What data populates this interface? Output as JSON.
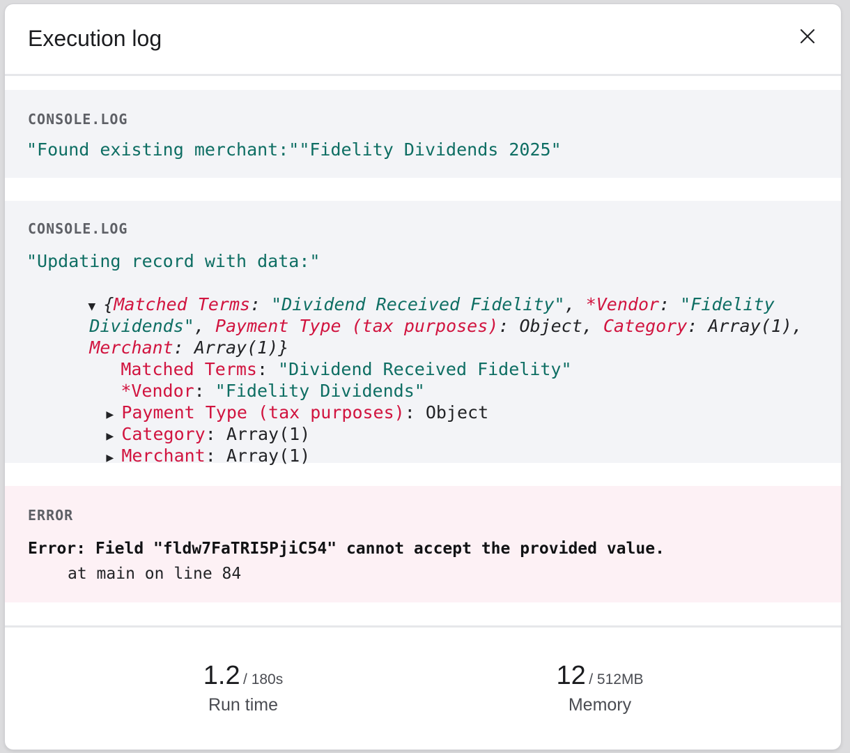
{
  "header": {
    "title": "Execution log"
  },
  "logs": [
    {
      "label": "CONSOLE.LOG",
      "message": "\"Found existing merchant:\"\"Fidelity Dividends 2025\""
    },
    {
      "label": "CONSOLE.LOG",
      "message": "\"Updating record with data:\"",
      "summary": {
        "open": "{",
        "k1": "Matched Terms",
        "v1": "\"Dividend Received Fidelity\"",
        "k2": "*Vendor",
        "v2a": "\"Fidelity",
        "v2b": "Dividends\"",
        "k3": "Payment Type (tax purposes)",
        "v3": "Object",
        "k4": "Category",
        "v4": "Array(1)",
        "k5": "Merchant",
        "v5": "Array(1)",
        "close": "}"
      },
      "props": [
        {
          "key": "Matched Terms",
          "value": "\"Dividend Received Fidelity\"",
          "expandable": false
        },
        {
          "key": "*Vendor",
          "value": "\"Fidelity Dividends\"",
          "expandable": false
        },
        {
          "key": "Payment Type (tax purposes)",
          "value": "Object",
          "expandable": true
        },
        {
          "key": "Category",
          "value": "Array(1)",
          "expandable": true
        },
        {
          "key": "Merchant",
          "value": "Array(1)",
          "expandable": true
        }
      ]
    }
  ],
  "error": {
    "label": "ERROR",
    "message": "Error: Field \"fldw7FaTRI5PjiC54\" cannot accept the provided value.",
    "trace": "at main on line 84"
  },
  "stats": {
    "run_time": {
      "value": "1.2",
      "limit": "/ 180s",
      "label": "Run time"
    },
    "memory": {
      "value": "12",
      "limit": "/ 512MB",
      "label": "Memory"
    }
  },
  "icons": {
    "close": "close-icon",
    "expanded": "triangle-down-icon",
    "collapsed": "triangle-right-icon"
  },
  "colors": {
    "string": "#0e6e63",
    "key": "#d1143f",
    "error_bg": "#fdf1f5",
    "log_bg": "#f3f4f7"
  }
}
